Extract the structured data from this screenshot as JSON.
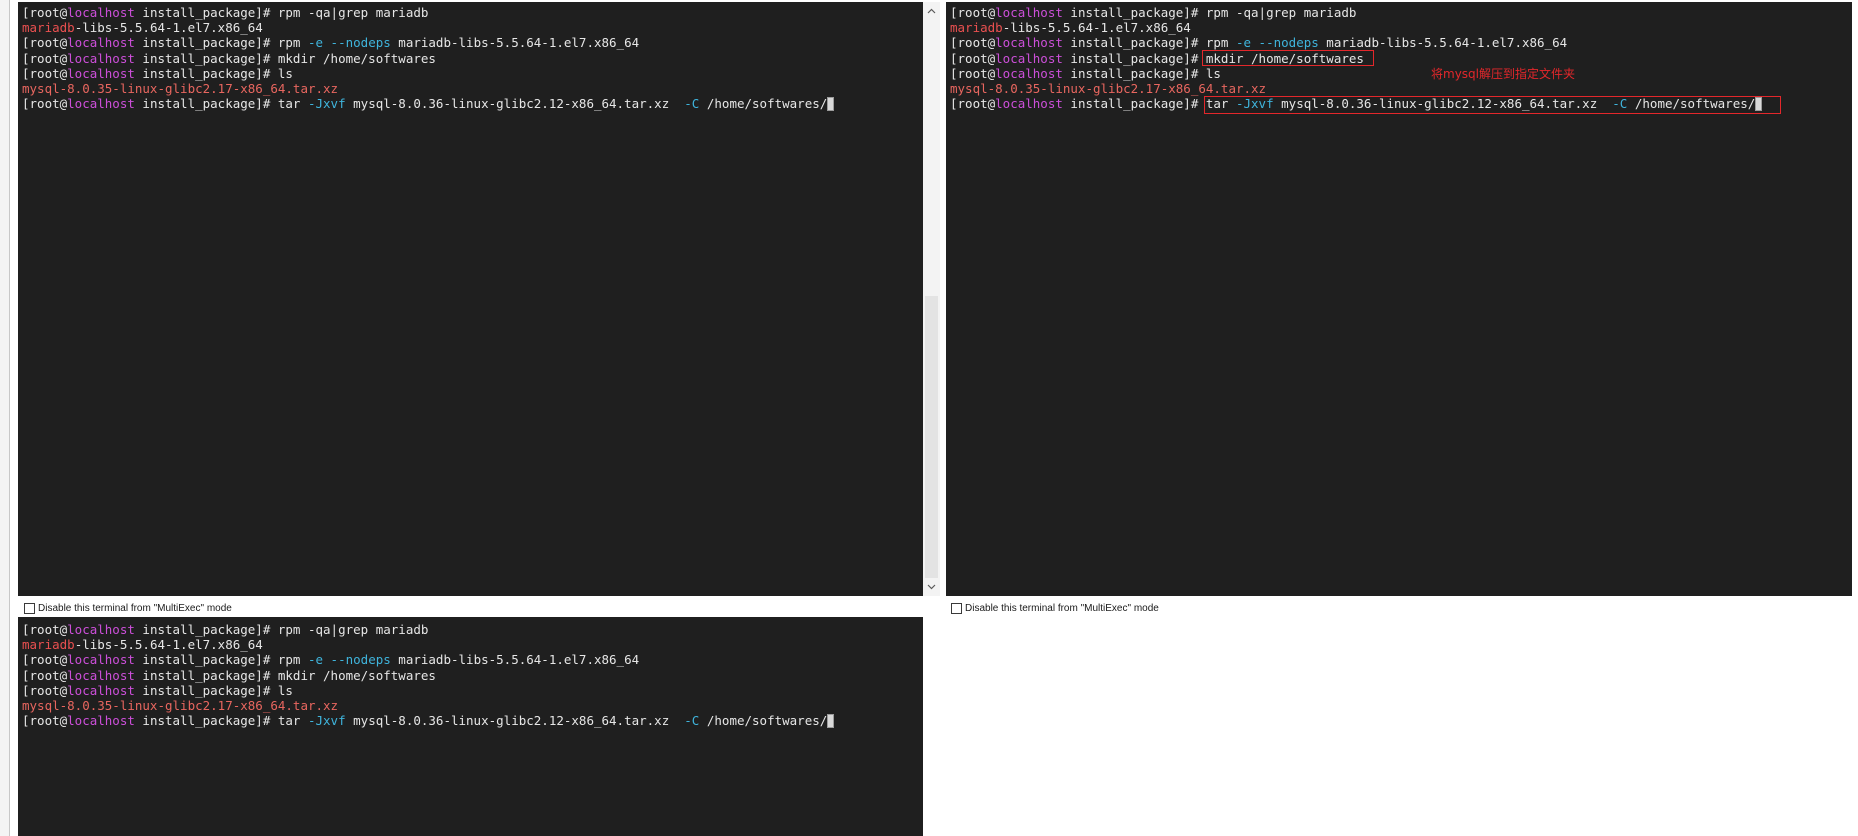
{
  "colors": {
    "background": "#1f1f1f",
    "cursor": "#d9d9d9",
    "annotation": "#e3272b"
  },
  "icons": {
    "scroll_up": "chevron-up-icon",
    "scroll_down": "chevron-down-icon"
  },
  "annotation": {
    "text": "将mysql解压到指定文件夹"
  },
  "panes": {
    "top_left": {
      "multiexec_checkbox": {
        "label": "Disable this terminal from \"MultiExec\" mode",
        "checked": false
      },
      "lines": [
        [
          {
            "t": "[root@",
            "color": "#e6e6e6"
          },
          {
            "t": "localhost",
            "color": "#cc4fd9"
          },
          {
            "t": " install_package]# rpm -qa|grep mariadb",
            "color": "#e6e6e6"
          }
        ],
        [
          {
            "t": "mariadb",
            "color": "#ea5050"
          },
          {
            "t": "-libs-5.5.64-1.el7.x86_64",
            "color": "#e6e6e6"
          }
        ],
        [
          {
            "t": "[root@",
            "color": "#e6e6e6"
          },
          {
            "t": "localhost",
            "color": "#cc4fd9"
          },
          {
            "t": " install_package]# rpm ",
            "color": "#e6e6e6"
          },
          {
            "t": "-e --nodeps",
            "color": "#3fb4dc"
          },
          {
            "t": " mariadb-libs-5.5.64-1.el7.x86_64",
            "color": "#e6e6e6"
          }
        ],
        [
          {
            "t": "[root@",
            "color": "#e6e6e6"
          },
          {
            "t": "localhost",
            "color": "#cc4fd9"
          },
          {
            "t": " install_package]# mkdir /home/softwares",
            "color": "#e6e6e6"
          }
        ],
        [
          {
            "t": "[root@",
            "color": "#e6e6e6"
          },
          {
            "t": "localhost",
            "color": "#cc4fd9"
          },
          {
            "t": " install_package]# ls",
            "color": "#e6e6e6"
          }
        ],
        [
          {
            "t": "mysql-8.0.35-linux-glibc2.17-x86_64.tar.xz",
            "color": "#e8665f"
          }
        ],
        [
          {
            "t": "[root@",
            "color": "#e6e6e6"
          },
          {
            "t": "localhost",
            "color": "#cc4fd9"
          },
          {
            "t": " install_package]# tar ",
            "color": "#e6e6e6"
          },
          {
            "t": "-Jxvf",
            "color": "#3fb4dc"
          },
          {
            "t": " mysql-8.0.36-linux-glibc2.12-x86_64.tar.xz  ",
            "color": "#e6e6e6"
          },
          {
            "t": "-C",
            "color": "#3fb4dc"
          },
          {
            "t": " /home/softwares/",
            "color": "#e6e6e6"
          }
        ]
      ]
    },
    "top_right": {
      "multiexec_checkbox": {
        "label": "Disable this terminal from \"MultiExec\" mode",
        "checked": false
      },
      "lines": [
        [
          {
            "t": "[root@",
            "color": "#e6e6e6"
          },
          {
            "t": "localhost",
            "color": "#cc4fd9"
          },
          {
            "t": " install_package]# rpm -qa|grep mariadb",
            "color": "#e6e6e6"
          }
        ],
        [
          {
            "t": "mariadb",
            "color": "#ea5050"
          },
          {
            "t": "-libs-5.5.64-1.el7.x86_64",
            "color": "#e6e6e6"
          }
        ],
        [
          {
            "t": "[root@",
            "color": "#e6e6e6"
          },
          {
            "t": "localhost",
            "color": "#cc4fd9"
          },
          {
            "t": " install_package]# rpm ",
            "color": "#e6e6e6"
          },
          {
            "t": "-e --nodeps",
            "color": "#3fb4dc"
          },
          {
            "t": " mariadb-libs-5.5.64-1.el7.x86_64",
            "color": "#e6e6e6"
          }
        ],
        [
          {
            "t": "[root@",
            "color": "#e6e6e6"
          },
          {
            "t": "localhost",
            "color": "#cc4fd9"
          },
          {
            "t": " install_package]# mkdir /home/softwares",
            "color": "#e6e6e6"
          }
        ],
        [
          {
            "t": "[root@",
            "color": "#e6e6e6"
          },
          {
            "t": "localhost",
            "color": "#cc4fd9"
          },
          {
            "t": " install_package]# ls",
            "color": "#e6e6e6"
          }
        ],
        [
          {
            "t": "mysql-8.0.35-linux-glibc2.17-x86_64.tar.xz",
            "color": "#e8665f"
          }
        ],
        [
          {
            "t": "[root@",
            "color": "#e6e6e6"
          },
          {
            "t": "localhost",
            "color": "#cc4fd9"
          },
          {
            "t": " install_package]# tar ",
            "color": "#e6e6e6"
          },
          {
            "t": "-Jxvf",
            "color": "#3fb4dc"
          },
          {
            "t": " mysql-8.0.36-linux-glibc2.12-x86_64.tar.xz  ",
            "color": "#e6e6e6"
          },
          {
            "t": "-C",
            "color": "#3fb4dc"
          },
          {
            "t": " /home/softwares/",
            "color": "#e6e6e6"
          }
        ]
      ]
    },
    "bottom_left": {
      "lines": [
        [
          {
            "t": "[root@",
            "color": "#e6e6e6"
          },
          {
            "t": "localhost",
            "color": "#cc4fd9"
          },
          {
            "t": " install_package]# rpm -qa|grep mariadb",
            "color": "#e6e6e6"
          }
        ],
        [
          {
            "t": "mariadb",
            "color": "#ea5050"
          },
          {
            "t": "-libs-5.5.64-1.el7.x86_64",
            "color": "#e6e6e6"
          }
        ],
        [
          {
            "t": "[root@",
            "color": "#e6e6e6"
          },
          {
            "t": "localhost",
            "color": "#cc4fd9"
          },
          {
            "t": " install_package]# rpm ",
            "color": "#e6e6e6"
          },
          {
            "t": "-e --nodeps",
            "color": "#3fb4dc"
          },
          {
            "t": " mariadb-libs-5.5.64-1.el7.x86_64",
            "color": "#e6e6e6"
          }
        ],
        [
          {
            "t": "[root@",
            "color": "#e6e6e6"
          },
          {
            "t": "localhost",
            "color": "#cc4fd9"
          },
          {
            "t": " install_package]# mkdir /home/softwares",
            "color": "#e6e6e6"
          }
        ],
        [
          {
            "t": "[root@",
            "color": "#e6e6e6"
          },
          {
            "t": "localhost",
            "color": "#cc4fd9"
          },
          {
            "t": " install_package]# ls",
            "color": "#e6e6e6"
          }
        ],
        [
          {
            "t": "mysql-8.0.35-linux-glibc2.17-x86_64.tar.xz",
            "color": "#e8665f"
          }
        ],
        [
          {
            "t": "[root@",
            "color": "#e6e6e6"
          },
          {
            "t": "localhost",
            "color": "#cc4fd9"
          },
          {
            "t": " install_package]# tar ",
            "color": "#e6e6e6"
          },
          {
            "t": "-Jxvf",
            "color": "#3fb4dc"
          },
          {
            "t": " mysql-8.0.36-linux-glibc2.12-x86_64.tar.xz  ",
            "color": "#e6e6e6"
          },
          {
            "t": "-C",
            "color": "#3fb4dc"
          },
          {
            "t": " /home/softwares/",
            "color": "#e6e6e6"
          }
        ]
      ]
    }
  }
}
